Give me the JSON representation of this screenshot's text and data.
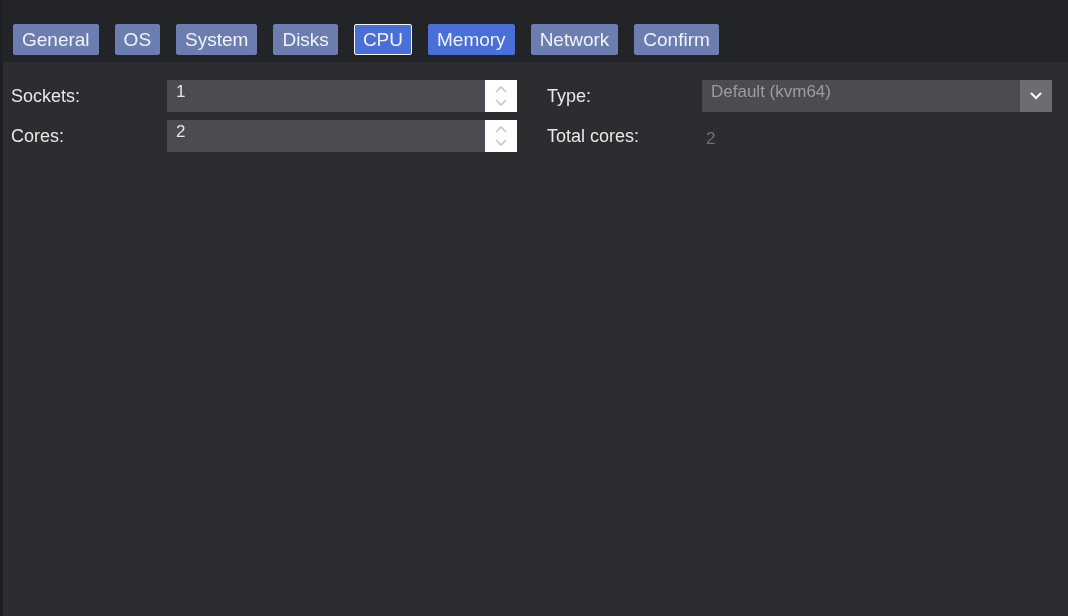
{
  "tabs": [
    {
      "label": "General",
      "selected": false,
      "hovered": false
    },
    {
      "label": "OS",
      "selected": false,
      "hovered": false
    },
    {
      "label": "System",
      "selected": false,
      "hovered": false
    },
    {
      "label": "Disks",
      "selected": false,
      "hovered": false
    },
    {
      "label": "CPU",
      "selected": true,
      "hovered": false
    },
    {
      "label": "Memory",
      "selected": false,
      "hovered": true
    },
    {
      "label": "Network",
      "selected": false,
      "hovered": false
    },
    {
      "label": "Confirm",
      "selected": false,
      "hovered": false
    }
  ],
  "left_fields": [
    {
      "label": "Sockets:",
      "value": "1"
    },
    {
      "label": "Cores:",
      "value": "2"
    }
  ],
  "type_field": {
    "label": "Type:",
    "value": "Default (kvm64)"
  },
  "total_cores": {
    "label": "Total cores:",
    "value": "2"
  }
}
